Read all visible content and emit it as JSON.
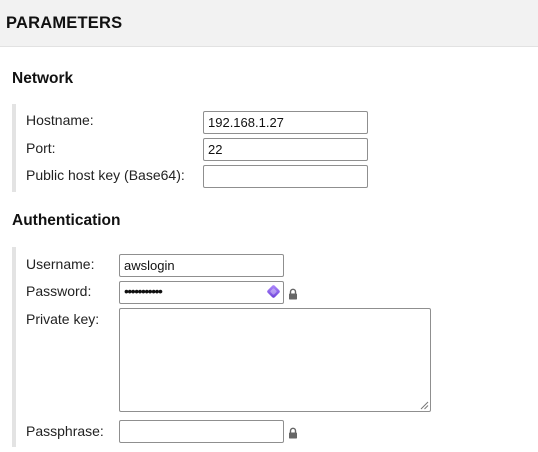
{
  "header": {
    "title": "PARAMETERS"
  },
  "network": {
    "title": "Network",
    "hostname": {
      "label": "Hostname:",
      "value": "192.168.1.27"
    },
    "port": {
      "label": "Port:",
      "value": "22"
    },
    "host_key": {
      "label": "Public host key (Base64):",
      "value": ""
    }
  },
  "authentication": {
    "title": "Authentication",
    "username": {
      "label": "Username:",
      "value": "awslogin"
    },
    "password": {
      "label": "Password:",
      "value": "•••••••••••",
      "icon": "password-manager-icon",
      "lock_icon": "lock-icon"
    },
    "private_key": {
      "label": "Private key:",
      "value": ""
    },
    "passphrase": {
      "label": "Passphrase:",
      "value": "",
      "lock_icon": "lock-icon"
    }
  },
  "colors": {
    "header_bg": "#f2f2f2",
    "section_bar": "#e3e3e3",
    "input_border": "#8f8f8f"
  }
}
